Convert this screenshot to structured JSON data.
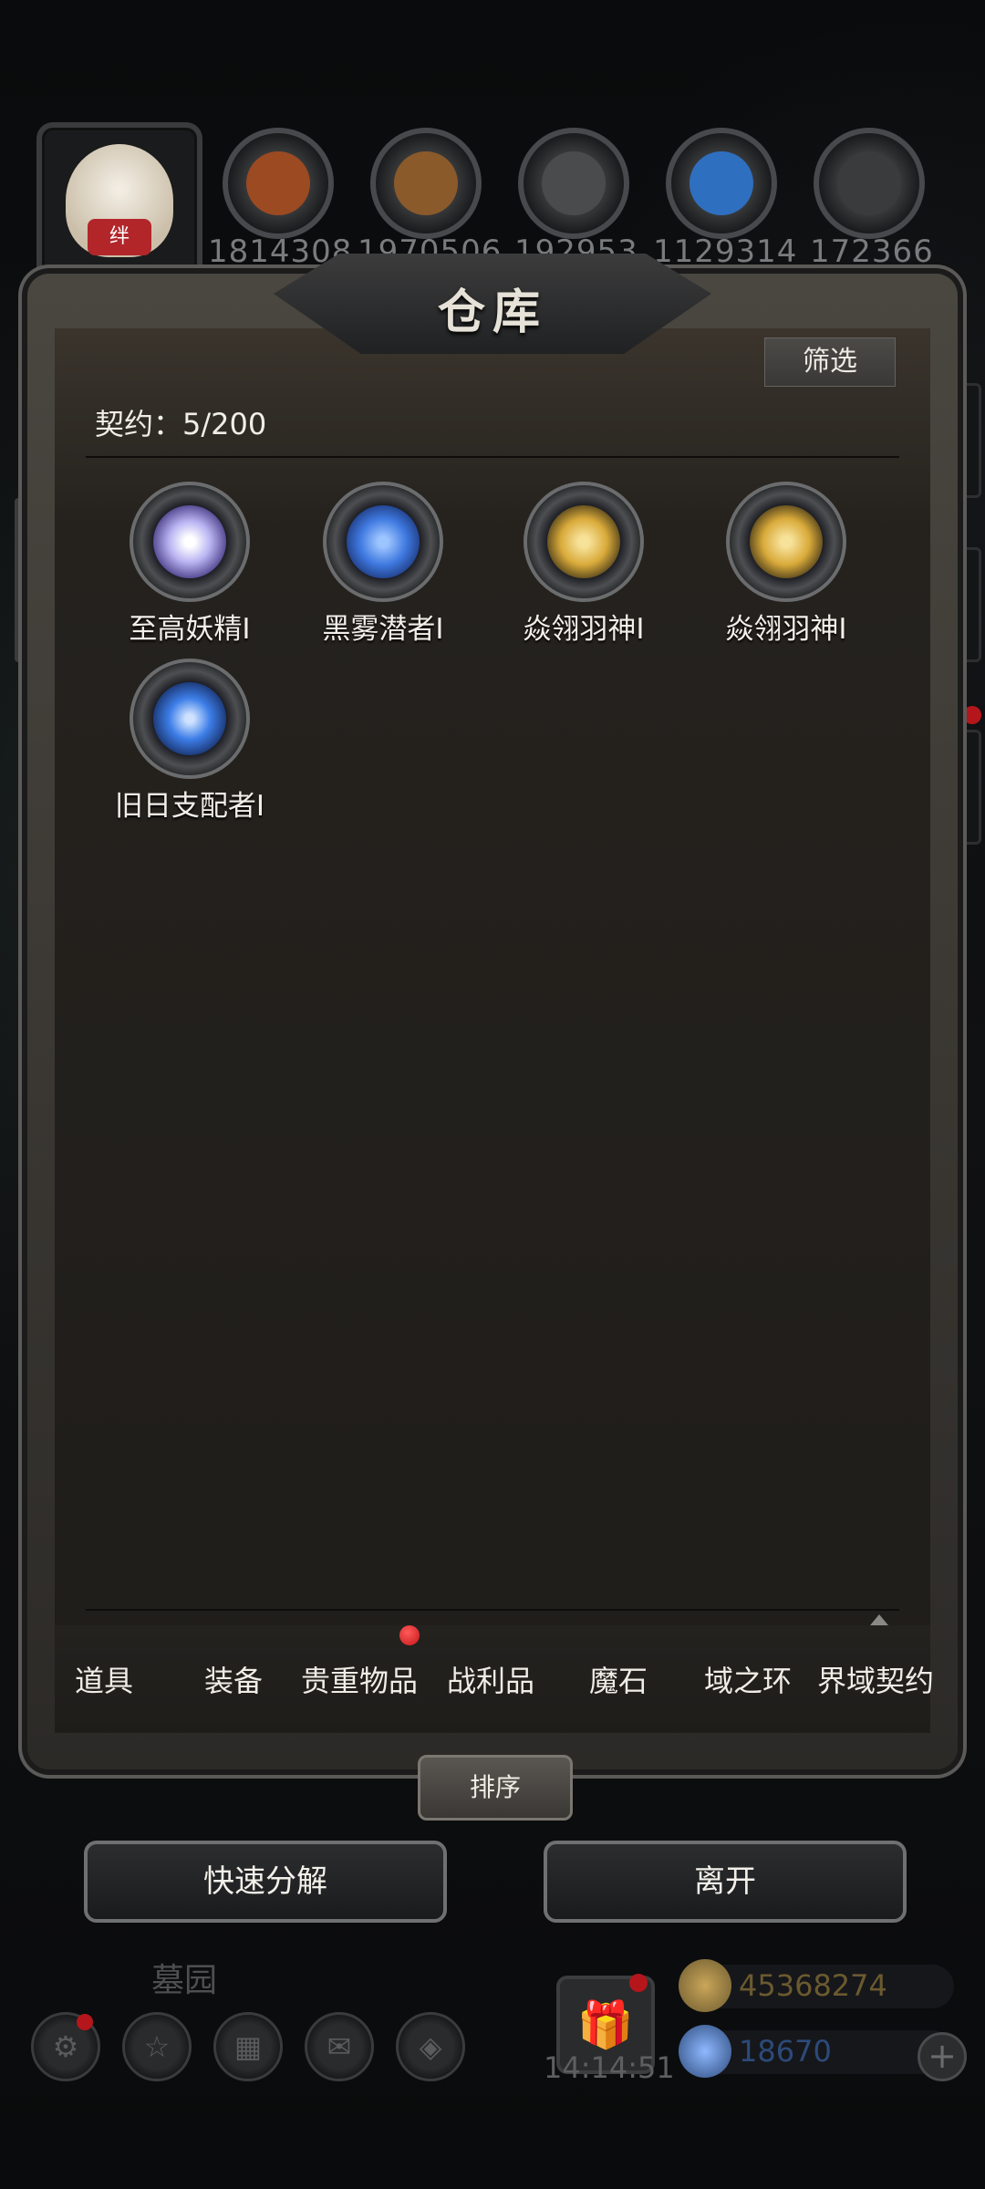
{
  "top_bar": {
    "avatar_badge": "绊",
    "resources": [
      {
        "icon": "meat-icon",
        "value": "1814308",
        "color": "#9b4a22"
      },
      {
        "icon": "wood-icon",
        "value": "1970506",
        "color": "#8a5a2b"
      },
      {
        "icon": "iron-ingot-icon",
        "value": "192953",
        "color": "#4a4b4d"
      },
      {
        "icon": "crystal-icon",
        "value": "1129314",
        "color": "#2f6fbf"
      },
      {
        "icon": "stone-icon",
        "value": "172366",
        "color": "#3a3b3d"
      }
    ]
  },
  "panel": {
    "title": "仓库",
    "filter_label": "筛选",
    "contract_count": "契约：5/200",
    "items": [
      {
        "label": "至高妖精Ⅰ",
        "icon": "fairy-crest-icon",
        "color": "#b9b4f2"
      },
      {
        "label": "黑雾潜者Ⅰ",
        "icon": "mist-swirl-icon",
        "color": "#3f79e0"
      },
      {
        "label": "焱翎羽神Ⅰ",
        "icon": "golden-wings-icon",
        "color": "#d9aa3a"
      },
      {
        "label": "焱翎羽神Ⅰ",
        "icon": "golden-wings-icon",
        "color": "#d9aa3a"
      },
      {
        "label": "旧日支配者Ⅰ",
        "icon": "eye-rune-icon",
        "color": "#3d7ee8"
      }
    ],
    "tabs": [
      "道具",
      "装备",
      "贵重物品",
      "战利品",
      "魔石",
      "域之环",
      "界域契约"
    ],
    "sort_label": "排序"
  },
  "actions": {
    "quick_decompose": "快速分解",
    "leave": "离开"
  },
  "hud": {
    "area_name": "墓园",
    "timer": "14:14:51",
    "gold": "45368274",
    "gems": "18670",
    "gold_color": "#6b5a30",
    "gem_color": "#2c4a7a"
  }
}
